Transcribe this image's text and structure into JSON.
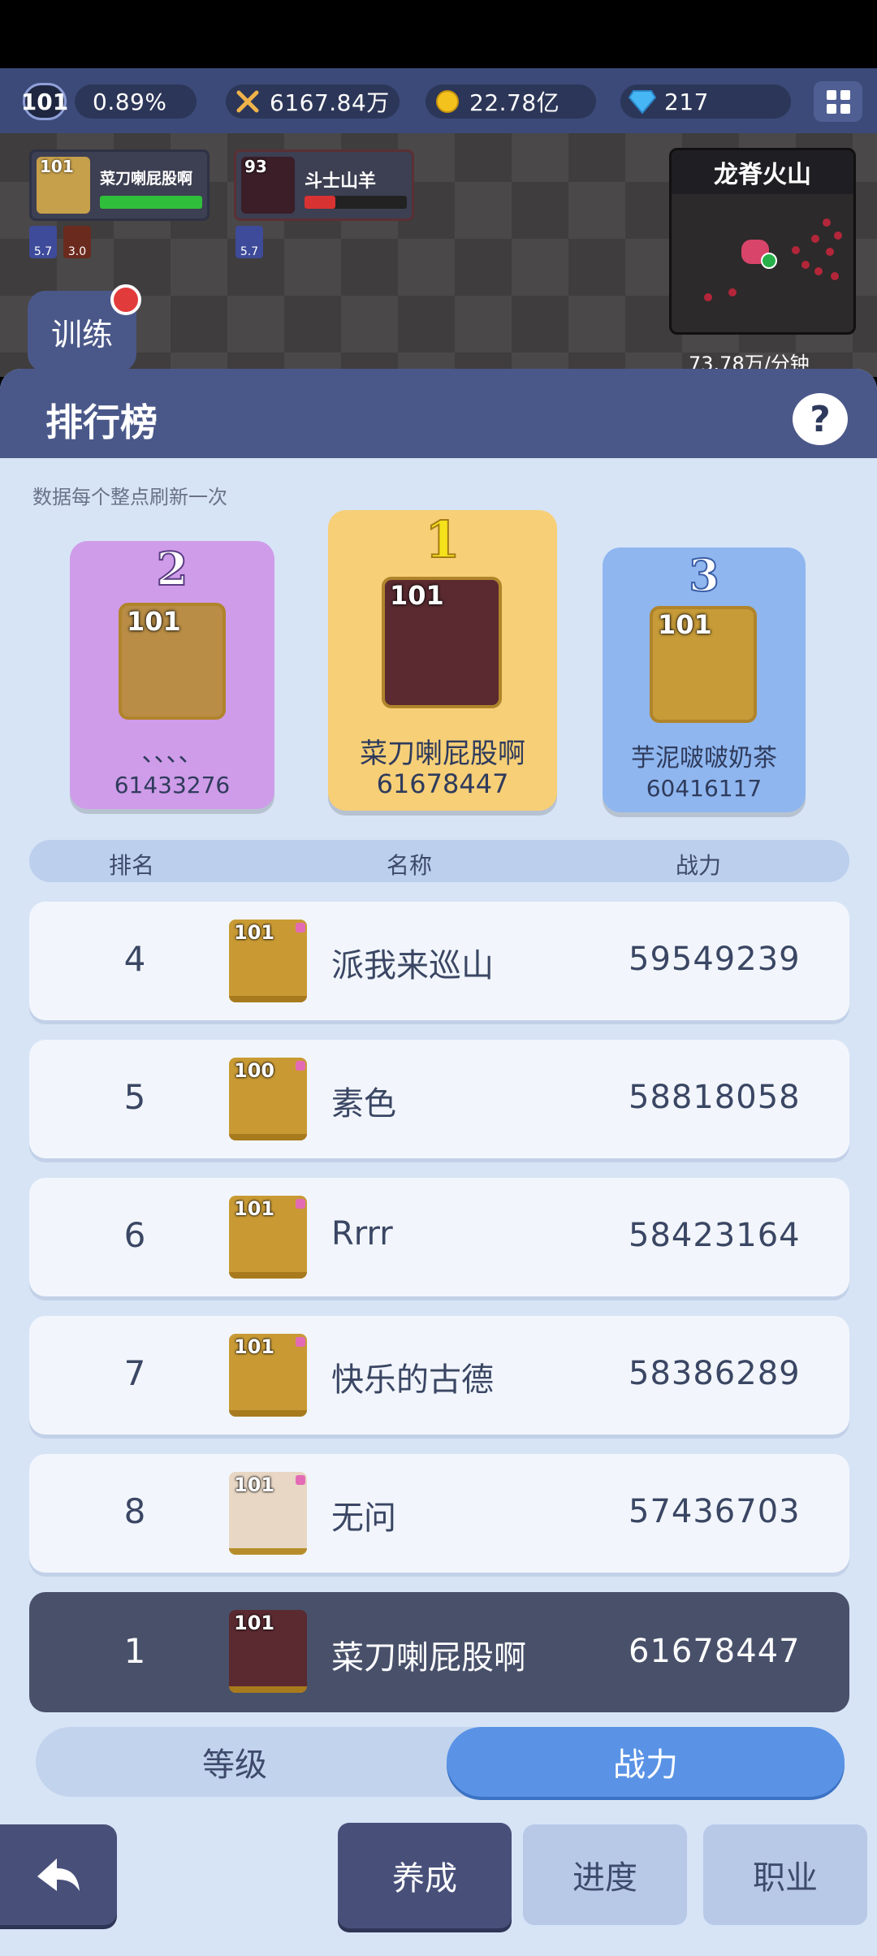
{
  "top": {
    "player_level": "101",
    "exp_percent": "0.89%",
    "combat": "6167.84万",
    "gold": "22.78亿",
    "gems": "217"
  },
  "units": [
    {
      "level": "101",
      "name": "菜刀喇屁股啊",
      "hp": 1.0,
      "hp_color": "#2fbf3a",
      "buffs": [
        "5.7",
        "3.0"
      ]
    },
    {
      "level": "93",
      "name": "斗士山羊",
      "hp": 0.3,
      "hp_color": "#d83232",
      "buffs": [
        "5.7"
      ]
    }
  ],
  "train_label": "训练",
  "map": {
    "title": "龙脊火山"
  },
  "rate": "73.78万/分钟",
  "panel": {
    "title": "排行榜",
    "help": "?",
    "refresh_note": "数据每个整点刷新一次"
  },
  "podium": [
    {
      "rank": "2",
      "level": "101",
      "name": "、、、、",
      "power": "61433276",
      "color": "#cf9ce9"
    },
    {
      "rank": "1",
      "level": "101",
      "name": "菜刀喇屁股啊",
      "power": "61678447",
      "color": "#f6cf77"
    },
    {
      "rank": "3",
      "level": "101",
      "name": "芋泥啵啵奶茶",
      "power": "60416117",
      "color": "#8fb6ef"
    }
  ],
  "columns": {
    "rank": "排名",
    "name": "名称",
    "power": "战力"
  },
  "rows": [
    {
      "rank": "4",
      "level": "101",
      "name": "派我来巡山",
      "power": "59549239"
    },
    {
      "rank": "5",
      "level": "100",
      "name": "素色",
      "power": "58818058"
    },
    {
      "rank": "6",
      "level": "101",
      "name": "Rrrr",
      "power": "58423164"
    },
    {
      "rank": "7",
      "level": "101",
      "name": "快乐的古德",
      "power": "58386289"
    },
    {
      "rank": "8",
      "level": "101",
      "name": "无问",
      "power": "57436703"
    }
  ],
  "self_row": {
    "rank": "1",
    "level": "101",
    "name": "菜刀喇屁股啊",
    "power": "61678447"
  },
  "tabs": {
    "level": "等级",
    "power": "战力"
  },
  "nav": {
    "cultivate": "养成",
    "progress": "进度",
    "job": "职业"
  }
}
